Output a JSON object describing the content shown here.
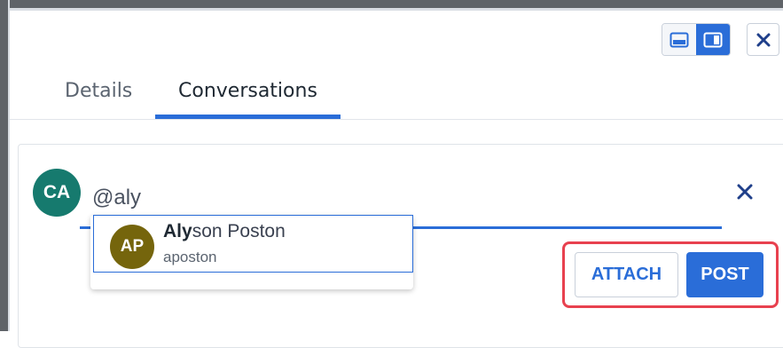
{
  "window": {
    "view_toggle": [
      {
        "icon": "panel-bottom-icon",
        "active": false
      },
      {
        "icon": "panel-right-icon",
        "active": true
      }
    ],
    "close_icon": "close-icon"
  },
  "tabs": [
    {
      "label": "Details",
      "active": false
    },
    {
      "label": "Conversations",
      "active": true
    }
  ],
  "composer": {
    "avatar_initials": "CA",
    "input_value": "@aly",
    "clear_icon": "close-icon",
    "attach_label": "ATTACH",
    "post_label": "POST"
  },
  "mention": {
    "query_match": "Aly",
    "name_rest": "son Poston",
    "username": "aposton",
    "avatar_initials": "AP"
  },
  "colors": {
    "accent": "#2a6dd8",
    "highlight": "#e8414f",
    "avatar_ca": "#167a6e",
    "avatar_ap": "#75650c"
  }
}
